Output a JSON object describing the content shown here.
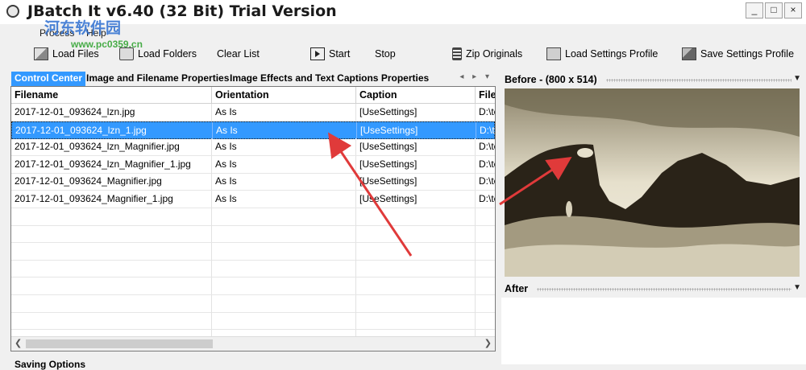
{
  "window": {
    "title": "JBatch It v6.40 (32 Bit) Trial Version",
    "buttons": {
      "minimize": "_",
      "maximize": "□",
      "close": "×"
    }
  },
  "menu": {
    "process": "Process",
    "help": "Help"
  },
  "toolbar": {
    "load_files": "Load Files",
    "load_folders": "Load Folders",
    "clear_list": "Clear List",
    "start": "Start",
    "stop": "Stop",
    "zip_originals": "Zip Originals",
    "load_settings_profile": "Load Settings Profile",
    "save_settings_profile": "Save Settings Profile"
  },
  "tabs": [
    {
      "label": "Control Center"
    },
    {
      "label": "Image and Filename Properties"
    },
    {
      "label": "Image Effects and Text Captions Properties"
    }
  ],
  "grid": {
    "columns": [
      "Filename",
      "Orientation",
      "Caption",
      "File"
    ],
    "rows": [
      {
        "filename": "2017-12-01_093624_lzn.jpg",
        "orientation": "As Is",
        "caption": "[UseSettings]",
        "file": "D:\\te"
      },
      {
        "filename": "2017-12-01_093624_lzn_1.jpg",
        "orientation": "As Is",
        "caption": "[UseSettings]",
        "file": "D:\\te"
      },
      {
        "filename": "2017-12-01_093624_lzn_Magnifier.jpg",
        "orientation": "As Is",
        "caption": "[UseSettings]",
        "file": "D:\\te"
      },
      {
        "filename": "2017-12-01_093624_lzn_Magnifier_1.jpg",
        "orientation": "As Is",
        "caption": "[UseSettings]",
        "file": "D:\\te"
      },
      {
        "filename": "2017-12-01_093624_Magnifier.jpg",
        "orientation": "As Is",
        "caption": "[UseSettings]",
        "file": "D:\\te"
      },
      {
        "filename": "2017-12-01_093624_Magnifier_1.jpg",
        "orientation": "As Is",
        "caption": "[UseSettings]",
        "file": "D:\\te"
      }
    ],
    "selected_index": 1
  },
  "saving_options_label": "Saving Options",
  "before_panel": {
    "label": "Before - (800 x 514)"
  },
  "after_panel": {
    "label": "After"
  },
  "watermark": {
    "text": "河东软件园",
    "url": "www.pc0359.cn"
  },
  "colors": {
    "selection": "#3399ff",
    "annotation_arrow": "#e03a3a"
  }
}
